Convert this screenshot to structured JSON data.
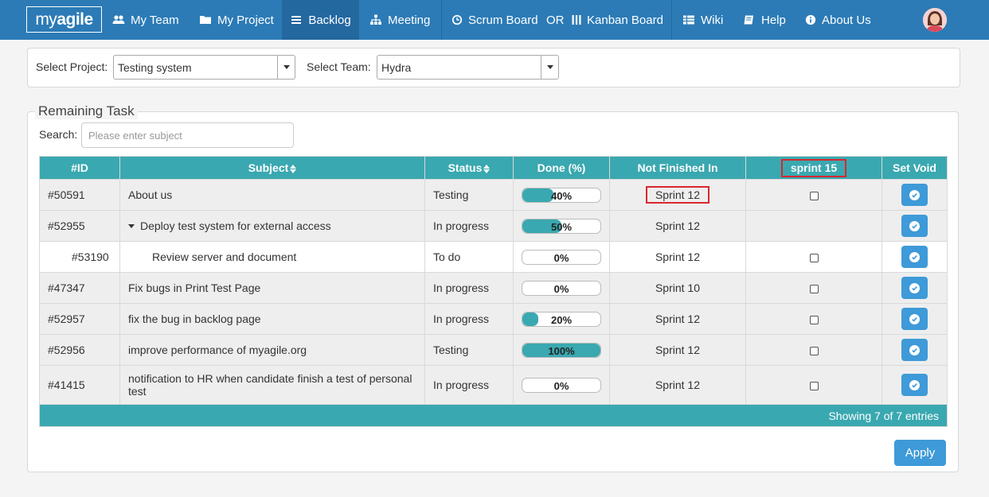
{
  "nav": {
    "logo_prefix": "my ",
    "logo_bold": "agile",
    "items": [
      {
        "label": "My Team",
        "icon": "users-icon"
      },
      {
        "label": "My Project",
        "icon": "folder-icon"
      },
      {
        "label": "Backlog",
        "icon": "list-icon"
      },
      {
        "label": "Meeting",
        "icon": "sitemap-icon"
      },
      {
        "label": "Scrum Board",
        "icon": "clock-icon"
      },
      {
        "label": "OR",
        "icon": ""
      },
      {
        "label": "Kanban Board",
        "icon": "columns-icon"
      },
      {
        "label": "Wiki",
        "icon": "table-icon"
      },
      {
        "label": "Help",
        "icon": "book-icon"
      },
      {
        "label": "About Us",
        "icon": "info-icon"
      }
    ],
    "active": "Backlog"
  },
  "filters": {
    "project_label": "Select Project:",
    "project_value": "Testing system",
    "team_label": "Select Team:",
    "team_value": "Hydra"
  },
  "remaining": {
    "legend": "Remaining Task",
    "search_label": "Search:",
    "search_placeholder": "Please enter subject",
    "columns": [
      "#ID",
      "Subject",
      "Status",
      "Done (%)",
      "Not Finished In",
      "sprint 15",
      "Set Void"
    ],
    "rows": [
      {
        "id": "#50591",
        "subject": "About us",
        "status": "Testing",
        "done": 40,
        "done_label": "40%",
        "sprint": "Sprint 12",
        "checkbox": true
      },
      {
        "id": "#52955",
        "subject": "Deploy test system for external access",
        "status": "In progress",
        "done": 50,
        "done_label": "50%",
        "sprint": "Sprint 12",
        "checkbox": false
      },
      {
        "id": "#53190",
        "subject": "Review server and document",
        "status": "To do",
        "done": 0,
        "done_label": "0%",
        "sprint": "Sprint 12",
        "checkbox": true
      },
      {
        "id": "#47347",
        "subject": "Fix bugs in Print Test Page",
        "status": "In progress",
        "done": 0,
        "done_label": "0%",
        "sprint": "Sprint 10",
        "checkbox": true
      },
      {
        "id": "#52957",
        "subject": "fix the bug in backlog page",
        "status": "In progress",
        "done": 20,
        "done_label": "20%",
        "sprint": "Sprint 12",
        "checkbox": true
      },
      {
        "id": "#52956",
        "subject": "improve performance of myagile.org",
        "status": "Testing",
        "done": 100,
        "done_label": "100%",
        "sprint": "Sprint 12",
        "checkbox": true
      },
      {
        "id": "#41415",
        "subject": "notification to HR when candidate finish a test of personal test",
        "status": "In progress",
        "done": 0,
        "done_label": "0%",
        "sprint": "Sprint 12",
        "checkbox": true
      }
    ],
    "footer": "Showing 7 of 7 entries",
    "apply_label": "Apply"
  },
  "colors": {
    "navbar": "#2c7bb6",
    "teal": "#3aa8b0",
    "button_blue": "#3e9ad8",
    "highlight_red": "#d9272e"
  }
}
